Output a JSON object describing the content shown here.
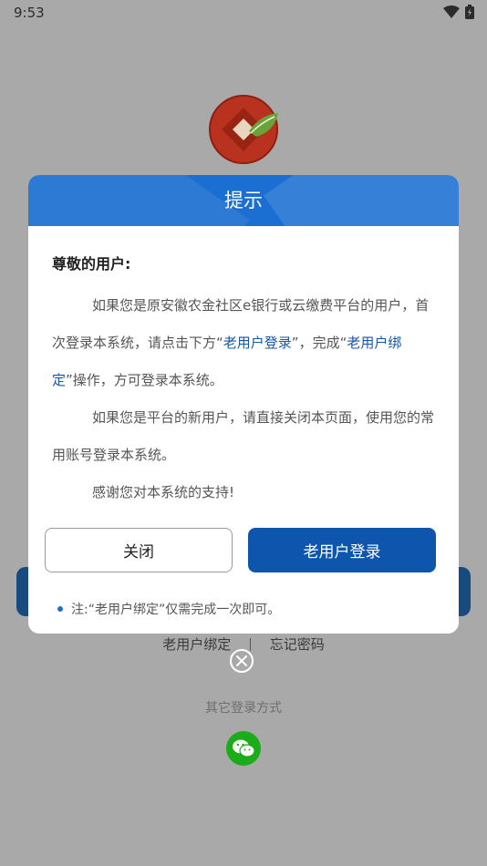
{
  "status_bar": {
    "time": "9:53"
  },
  "dialog": {
    "title": "提示",
    "greeting": "尊敬的用户:",
    "para1_a": "如果您是原安徽农金社区e银行或云缴费平台的用户，首次登录本系统，请点击下方“",
    "para1_hl1": "老用户登录",
    "para1_b": "”，完成“",
    "para1_hl2": "老用户绑定",
    "para1_c": "”操作，方可登录本系统。",
    "para2": "如果您是平台的新用户，请直接关闭本页面，使用您的常用账号登录本系统。",
    "para3": "感谢您对本系统的支持!",
    "close_label": "关闭",
    "login_label": "老用户登录",
    "note": "注:“老用户绑定”仅需完成一次即可。"
  },
  "background": {
    "link_bind": "老用户绑定",
    "link_forgot": "忘记密码",
    "other_login": "其它登录方式"
  },
  "icons": {
    "logo": "bank-logo-icon",
    "wechat": "wechat-icon",
    "dismiss": "close-circle-icon"
  },
  "colors": {
    "primary": "#0e56ad",
    "header": "#1c6fd2",
    "highlight": "#1556a6",
    "wechat": "#1aad19"
  }
}
